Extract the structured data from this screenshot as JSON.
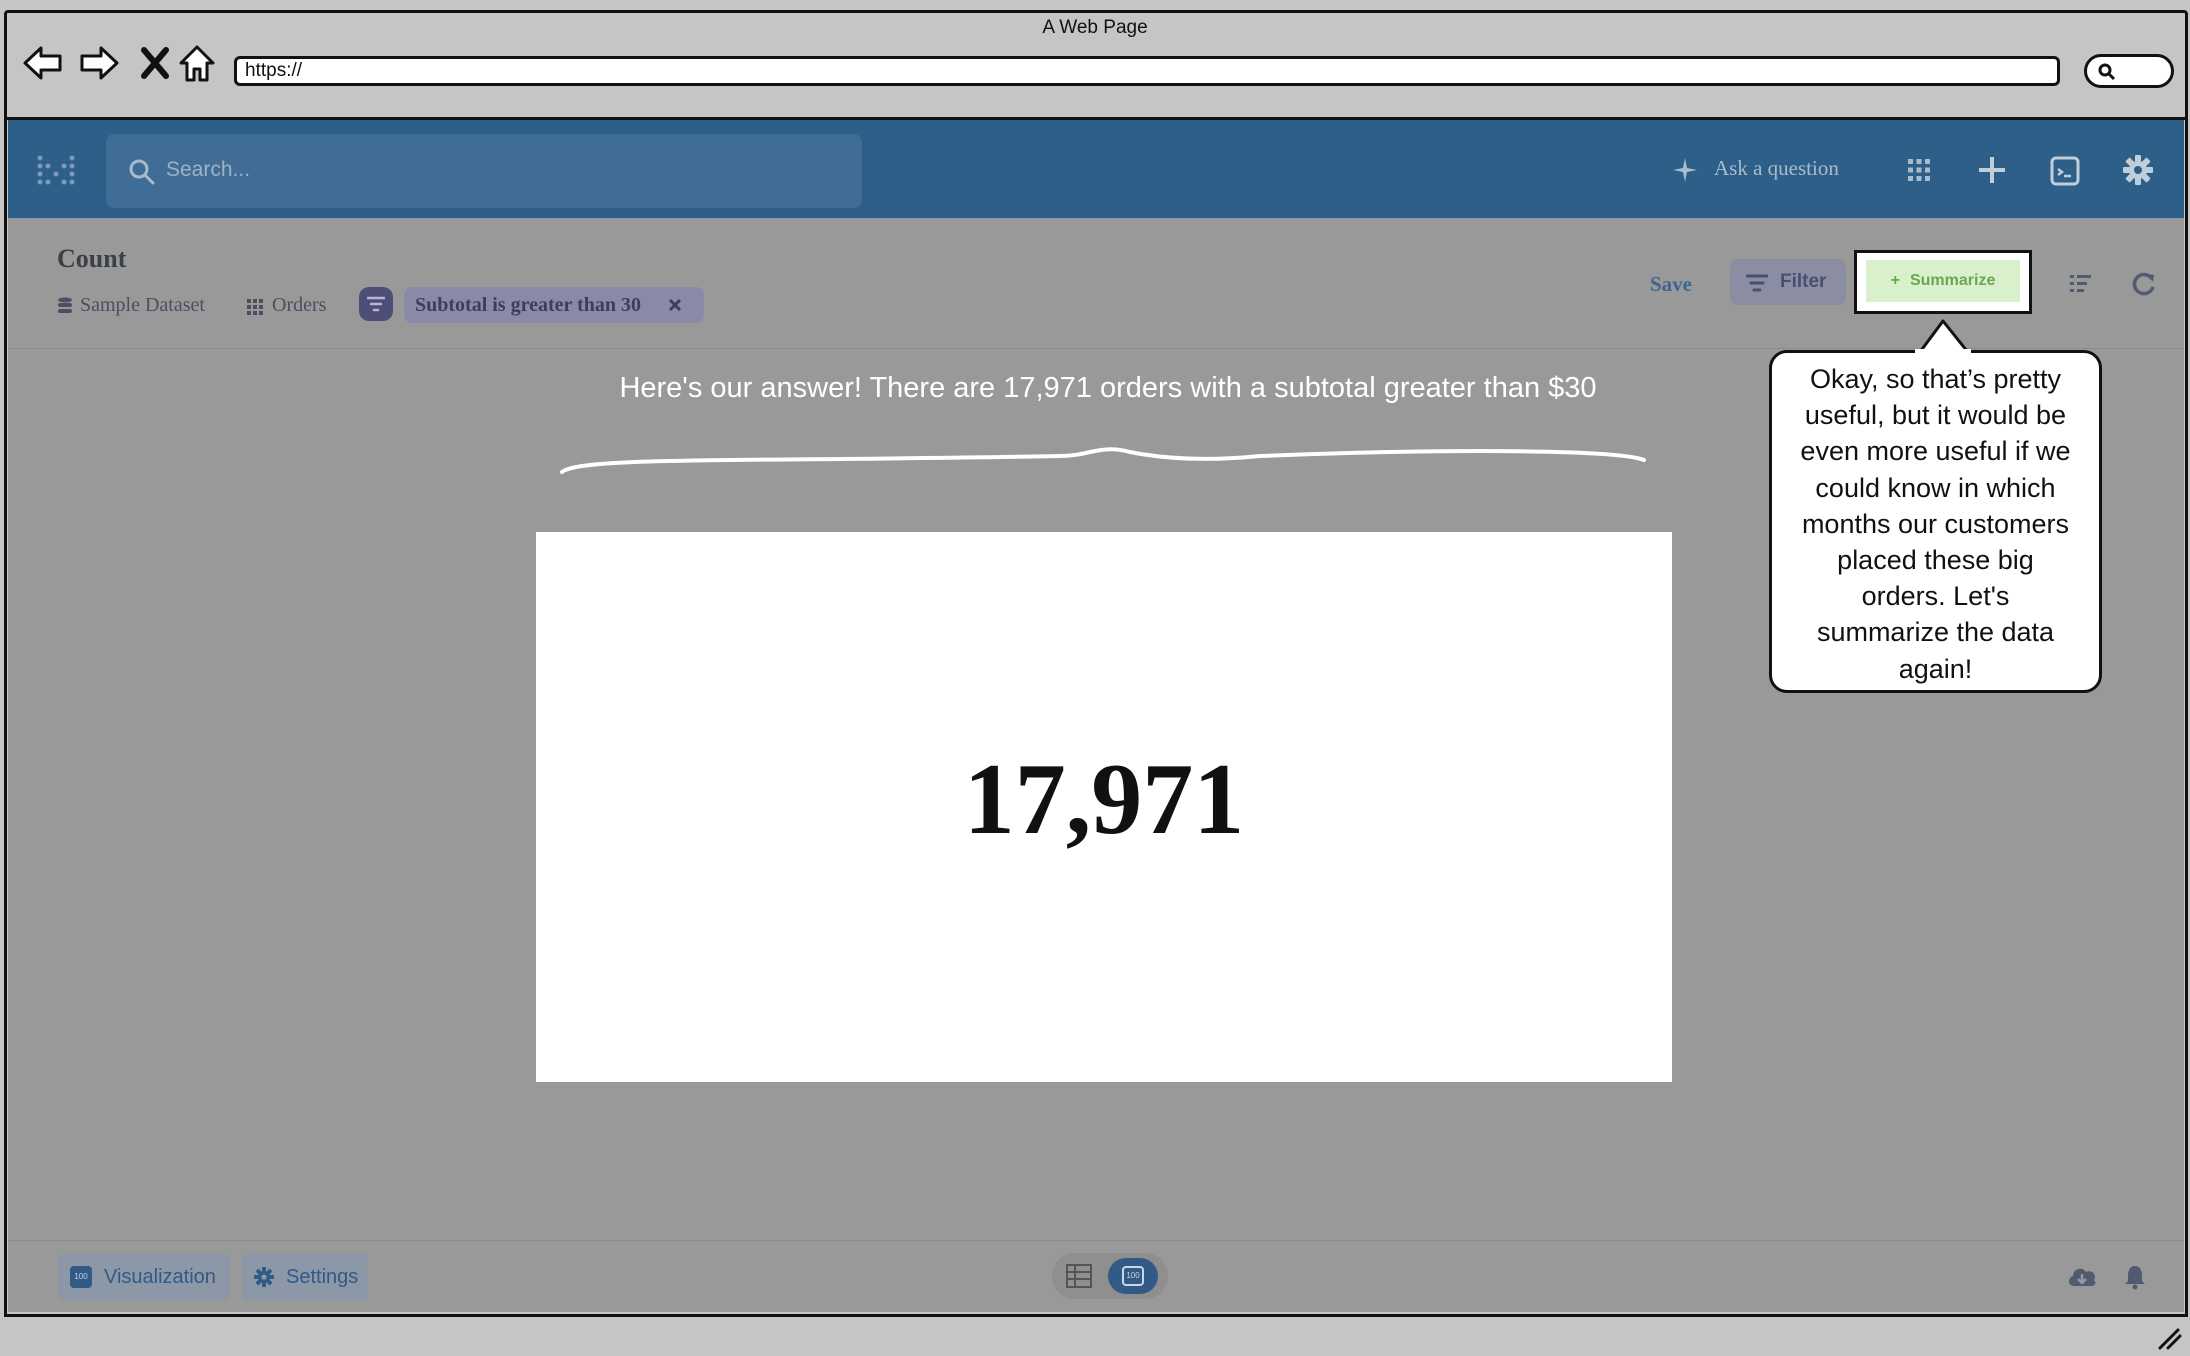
{
  "browser": {
    "title": "A Web Page",
    "url": "https://"
  },
  "appbar": {
    "search_placeholder": "Search...",
    "ask_label": "Ask a question"
  },
  "header": {
    "title": "Count",
    "breadcrumbs": [
      "Sample Dataset",
      "Orders"
    ],
    "filter_chip": "Subtotal is greater than 30",
    "save_label": "Save",
    "filter_label": "Filter",
    "summarize_label": "Summarize"
  },
  "main": {
    "annotation": "Here's our answer! There are 17,971 orders with a subtotal greater than $30",
    "value": "17,971"
  },
  "callout": {
    "lines": [
      "Okay, so that’s pretty",
      "useful, but it would be",
      "even more useful if we",
      "could know in which",
      "months our customers",
      "placed these big",
      "orders. Let's",
      "summarize the data",
      "again!"
    ]
  },
  "footer": {
    "visualization_label": "Visualization",
    "settings_label": "Settings",
    "toggle_badge": "100"
  },
  "colors": {
    "appbar": "#2e5f88",
    "summarize_bg": "#d9f0cc",
    "summarize_text": "#6aa84f",
    "overlay": "#999999"
  }
}
